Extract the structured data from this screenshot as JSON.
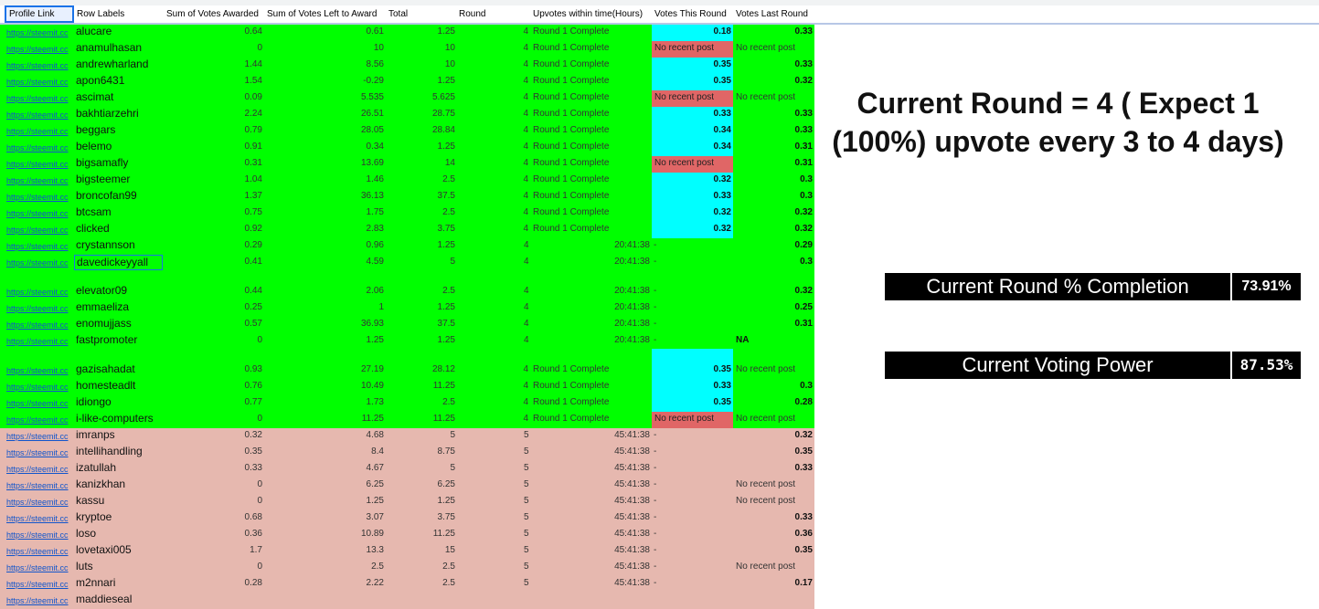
{
  "headers": [
    "Profile Link",
    "Row Labels",
    "Sum of Votes Awarded",
    "Sum of Votes Left to Award",
    "Total",
    "Round",
    "Upvotes within time(Hours)",
    "Votes This Round",
    "Votes Last Round"
  ],
  "rows": [
    {
      "link": "https://steemit.cc",
      "label": "alucare",
      "awarded": "0.64",
      "left": "0.61",
      "total": "1.25",
      "round": "4",
      "upvotes": "Round 1 Complete",
      "this_round": "0.18",
      "last_round": "0.33",
      "group": "green",
      "this_style": "cyan",
      "last_bold": true,
      "round_style": "num"
    },
    {
      "link": "https://steemit.cc",
      "label": "anamulhasan",
      "awarded": "0",
      "left": "10",
      "total": "10",
      "round": "4",
      "upvotes": "Round 1 Complete",
      "this_round": "No recent post",
      "last_round": "No recent post",
      "group": "green",
      "this_style": "salmon",
      "last_bold": false,
      "round_style": "num"
    },
    {
      "link": "https://steemit.cc",
      "label": "andrewharland",
      "awarded": "1.44",
      "left": "8.56",
      "total": "10",
      "round": "4",
      "upvotes": "Round 1 Complete",
      "this_round": "0.35",
      "last_round": "0.33",
      "group": "green",
      "this_style": "cyan",
      "last_bold": true,
      "round_style": "num"
    },
    {
      "link": "https://steemit.cc",
      "label": "apon6431",
      "awarded": "1.54",
      "left": "-0.29",
      "total": "1.25",
      "round": "4",
      "upvotes": "Round 1 Complete",
      "this_round": "0.35",
      "last_round": "0.32",
      "group": "green",
      "this_style": "cyan",
      "last_bold": true,
      "round_style": "num"
    },
    {
      "link": "https://steemit.cc",
      "label": "ascimat",
      "awarded": "0.09",
      "left": "5.535",
      "total": "5.625",
      "round": "4",
      "upvotes": "Round 1 Complete",
      "this_round": "No recent post",
      "last_round": "No recent post",
      "group": "green",
      "this_style": "salmon",
      "last_bold": false,
      "round_style": "num"
    },
    {
      "link": "https://steemit.cc",
      "label": "bakhtiarzehri",
      "awarded": "2.24",
      "left": "26.51",
      "total": "28.75",
      "round": "4",
      "upvotes": "Round 1 Complete",
      "this_round": "0.33",
      "last_round": "0.33",
      "group": "green",
      "this_style": "cyan",
      "last_bold": true,
      "round_style": "num"
    },
    {
      "link": "https://steemit.cc",
      "label": "beggars",
      "awarded": "0.79",
      "left": "28.05",
      "total": "28.84",
      "round": "4",
      "upvotes": "Round 1 Complete",
      "this_round": "0.34",
      "last_round": "0.33",
      "group": "green",
      "this_style": "cyan",
      "last_bold": true,
      "round_style": "num"
    },
    {
      "link": "https://steemit.cc",
      "label": "belemo",
      "awarded": "0.91",
      "left": "0.34",
      "total": "1.25",
      "round": "4",
      "upvotes": "Round 1 Complete",
      "this_round": "0.34",
      "last_round": "0.31",
      "group": "green",
      "this_style": "cyan",
      "last_bold": true,
      "round_style": "num"
    },
    {
      "link": "https://steemit.cc",
      "label": "bigsamafly",
      "awarded": "0.31",
      "left": "13.69",
      "total": "14",
      "round": "4",
      "upvotes": "Round 1 Complete",
      "this_round": "No recent post",
      "last_round": "0.31",
      "group": "green",
      "this_style": "salmon",
      "last_bold": true,
      "round_style": "num"
    },
    {
      "link": "https://steemit.cc",
      "label": "bigsteemer",
      "awarded": "1.04",
      "left": "1.46",
      "total": "2.5",
      "round": "4",
      "upvotes": "Round 1 Complete",
      "this_round": "0.32",
      "last_round": "0.3",
      "group": "green",
      "this_style": "cyan",
      "last_bold": true,
      "round_style": "num"
    },
    {
      "link": "https://steemit.cc",
      "label": "broncofan99",
      "awarded": "1.37",
      "left": "36.13",
      "total": "37.5",
      "round": "4",
      "upvotes": "Round 1 Complete",
      "this_round": "0.33",
      "last_round": "0.3",
      "group": "green",
      "this_style": "cyan",
      "last_bold": true,
      "round_style": "num"
    },
    {
      "link": "https://steemit.cc",
      "label": "btcsam",
      "awarded": "0.75",
      "left": "1.75",
      "total": "2.5",
      "round": "4",
      "upvotes": "Round 1 Complete",
      "this_round": "0.32",
      "last_round": "0.32",
      "group": "green",
      "this_style": "cyan",
      "last_bold": true,
      "round_style": "num"
    },
    {
      "link": "https://steemit.cc",
      "label": "clicked",
      "awarded": "0.92",
      "left": "2.83",
      "total": "3.75",
      "round": "4",
      "upvotes": "Round 1 Complete",
      "this_round": "0.32",
      "last_round": "0.32",
      "group": "green",
      "this_style": "cyan",
      "last_bold": true,
      "round_style": "num"
    },
    {
      "link": "https://steemit.cc",
      "label": "crystannson",
      "awarded": "0.29",
      "left": "0.96",
      "total": "1.25",
      "round": "4",
      "upvotes": "20:41:38",
      "this_round": "-",
      "last_round": "0.29",
      "group": "green",
      "this_style": "plain",
      "last_bold": true,
      "round_style": "left"
    },
    {
      "link": "https://steemit.cc",
      "label": "davedickeyyall",
      "awarded": "0.41",
      "left": "4.59",
      "total": "5",
      "round": "4",
      "upvotes": "20:41:38",
      "this_round": "-",
      "last_round": "0.3",
      "group": "green",
      "this_style": "plain",
      "last_bold": true,
      "round_style": "left",
      "boxed": true,
      "tall": true
    },
    {
      "link": "https://steemit.cc",
      "label": "elevator09",
      "awarded": "0.44",
      "left": "2.06",
      "total": "2.5",
      "round": "4",
      "upvotes": "20:41:38",
      "this_round": "-",
      "last_round": "0.32",
      "group": "green",
      "this_style": "plain",
      "last_bold": true,
      "round_style": "left"
    },
    {
      "link": "https://steemit.cc",
      "label": "emmaeliza",
      "awarded": "0.25",
      "left": "1",
      "total": "1.25",
      "round": "4",
      "upvotes": "20:41:38",
      "this_round": "-",
      "last_round": "0.25",
      "group": "green",
      "this_style": "plain",
      "last_bold": true,
      "round_style": "left"
    },
    {
      "link": "https://steemit.cc",
      "label": "enomujjass",
      "awarded": "0.57",
      "left": "36.93",
      "total": "37.5",
      "round": "4",
      "upvotes": "20:41:38",
      "this_round": "-",
      "last_round": "0.31",
      "group": "green",
      "this_style": "plain",
      "last_bold": true,
      "round_style": "left"
    },
    {
      "link": "https://steemit.cc",
      "label": "fastpromoter",
      "awarded": "0",
      "left": "1.25",
      "total": "1.25",
      "round": "4",
      "upvotes": "20:41:38",
      "this_round": "-",
      "last_round": "NA",
      "group": "green",
      "this_style": "plain",
      "last_bold": true,
      "last_left": true,
      "round_style": "left",
      "tall": true
    },
    {
      "link": "https://steemit.cc",
      "label": "gazisahadat",
      "awarded": "0.93",
      "left": "27.19",
      "total": "28.12",
      "round": "4",
      "upvotes": "Round 1 Complete",
      "this_round": "0.35",
      "last_round": "No recent post",
      "group": "green",
      "this_style": "cyan",
      "last_bold": false,
      "round_style": "num"
    },
    {
      "link": "https://steemit.cc",
      "label": "homesteadlt",
      "awarded": "0.76",
      "left": "10.49",
      "total": "11.25",
      "round": "4",
      "upvotes": "Round 1 Complete",
      "this_round": "0.33",
      "last_round": "0.3",
      "group": "green",
      "this_style": "cyan",
      "last_bold": true,
      "round_style": "num"
    },
    {
      "link": "https://steemit.cc",
      "label": "idiongo",
      "awarded": "0.77",
      "left": "1.73",
      "total": "2.5",
      "round": "4",
      "upvotes": "Round 1 Complete",
      "this_round": "0.35",
      "last_round": "0.28",
      "group": "green",
      "this_style": "cyan",
      "last_bold": true,
      "round_style": "num"
    },
    {
      "link": "https://steemit.cc",
      "label": "i-like-computers",
      "awarded": "0",
      "left": "11.25",
      "total": "11.25",
      "round": "4",
      "upvotes": "Round 1 Complete",
      "this_round": "No recent post",
      "last_round": "No recent post",
      "group": "green",
      "this_style": "salmon",
      "last_bold": false,
      "round_style": "num"
    },
    {
      "link": "https://steemit.cc",
      "label": "imranps",
      "awarded": "0.32",
      "left": "4.68",
      "total": "5",
      "round": "5",
      "upvotes": "45:41:38",
      "this_round": "-",
      "last_round": "0.32",
      "group": "pink",
      "this_style": "plain",
      "last_bold": true,
      "round_style": "left"
    },
    {
      "link": "https://steemit.cc",
      "label": "intellihandling",
      "awarded": "0.35",
      "left": "8.4",
      "total": "8.75",
      "round": "5",
      "upvotes": "45:41:38",
      "this_round": "-",
      "last_round": "0.35",
      "group": "pink",
      "this_style": "plain",
      "last_bold": true,
      "round_style": "left"
    },
    {
      "link": "https://steemit.cc",
      "label": "izatullah",
      "awarded": "0.33",
      "left": "4.67",
      "total": "5",
      "round": "5",
      "upvotes": "45:41:38",
      "this_round": "-",
      "last_round": "0.33",
      "group": "pink",
      "this_style": "plain",
      "last_bold": true,
      "round_style": "left"
    },
    {
      "link": "https://steemit.cc",
      "label": "kanizkhan",
      "awarded": "0",
      "left": "6.25",
      "total": "6.25",
      "round": "5",
      "upvotes": "45:41:38",
      "this_round": "-",
      "last_round": "No recent post",
      "group": "pink",
      "this_style": "plain",
      "last_bold": false,
      "round_style": "left"
    },
    {
      "link": "https://steemit.cc",
      "label": "kassu",
      "awarded": "0",
      "left": "1.25",
      "total": "1.25",
      "round": "5",
      "upvotes": "45:41:38",
      "this_round": "-",
      "last_round": "No recent post",
      "group": "pink",
      "this_style": "plain",
      "last_bold": false,
      "round_style": "left"
    },
    {
      "link": "https://steemit.cc",
      "label": "kryptoe",
      "awarded": "0.68",
      "left": "3.07",
      "total": "3.75",
      "round": "5",
      "upvotes": "45:41:38",
      "this_round": "-",
      "last_round": "0.33",
      "group": "pink",
      "this_style": "plain",
      "last_bold": true,
      "round_style": "left"
    },
    {
      "link": "https://steemit.cc",
      "label": "loso",
      "awarded": "0.36",
      "left": "10.89",
      "total": "11.25",
      "round": "5",
      "upvotes": "45:41:38",
      "this_round": "-",
      "last_round": "0.36",
      "group": "pink",
      "this_style": "plain",
      "last_bold": true,
      "round_style": "left"
    },
    {
      "link": "https://steemit.cc",
      "label": "lovetaxi005",
      "awarded": "1.7",
      "left": "13.3",
      "total": "15",
      "round": "5",
      "upvotes": "45:41:38",
      "this_round": "-",
      "last_round": "0.35",
      "group": "pink",
      "this_style": "plain",
      "last_bold": true,
      "round_style": "left"
    },
    {
      "link": "https://steemit.cc",
      "label": "luts",
      "awarded": "0",
      "left": "2.5",
      "total": "2.5",
      "round": "5",
      "upvotes": "45:41:38",
      "this_round": "-",
      "last_round": "No recent post",
      "group": "pink",
      "this_style": "plain",
      "last_bold": false,
      "round_style": "left"
    },
    {
      "link": "https://steemit.cc",
      "label": "m2nnari",
      "awarded": "0.28",
      "left": "2.22",
      "total": "2.5",
      "round": "5",
      "upvotes": "45:41:38",
      "this_round": "-",
      "last_round": "0.17",
      "group": "pink",
      "this_style": "plain",
      "last_bold": true,
      "round_style": "left"
    },
    {
      "link": "https://steemit.cc",
      "label": "maddieseal",
      "awarded": "",
      "left": "",
      "total": "",
      "round": "",
      "upvotes": "",
      "this_round": "",
      "last_round": "",
      "group": "pink",
      "this_style": "plain",
      "last_bold": false,
      "round_style": "left"
    }
  ],
  "big_title": "Current Round = 4 ( Expect 1 (100%) upvote every 3 to 4 days)",
  "stats": [
    {
      "label": "Current Round % Completion",
      "value": "73.91%"
    },
    {
      "label": "Current Voting Power",
      "value": "87.53%"
    }
  ]
}
